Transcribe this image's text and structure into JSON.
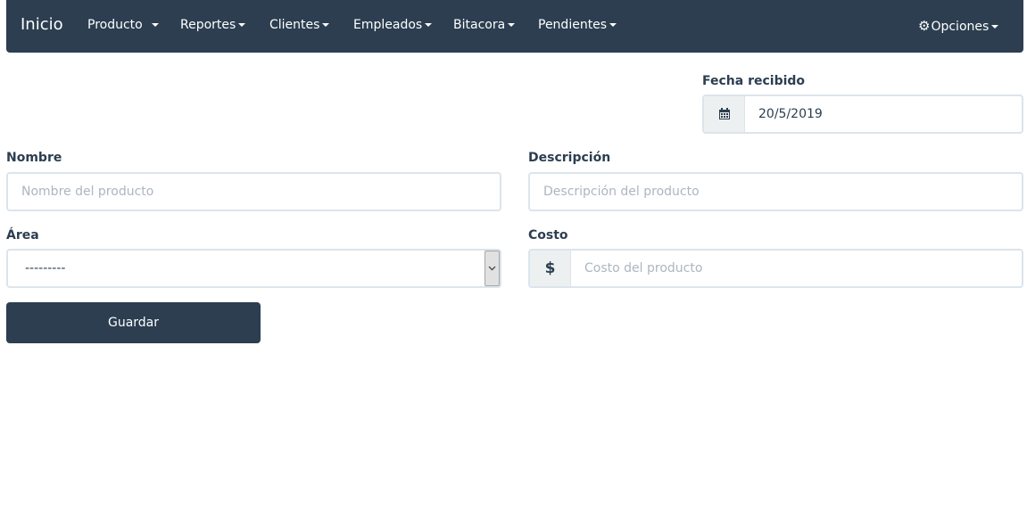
{
  "nav": {
    "brand": "Inicio",
    "items": [
      {
        "label": "Producto"
      },
      {
        "label": "Reportes"
      },
      {
        "label": "Clientes"
      },
      {
        "label": "Empleados"
      },
      {
        "label": "Bitacora"
      },
      {
        "label": "Pendientes"
      }
    ],
    "options_label": "Opciones"
  },
  "form": {
    "fecha": {
      "label": "Fecha recibido",
      "value": "20/5/2019",
      "icon": "calendar-icon"
    },
    "nombre": {
      "label": "Nombre",
      "placeholder": "Nombre del producto",
      "value": ""
    },
    "descripcion": {
      "label": "Descripción",
      "placeholder": "Descripción del producto",
      "value": ""
    },
    "area": {
      "label": "Área",
      "selected": "---------"
    },
    "costo": {
      "label": "Costo",
      "addon": "$",
      "placeholder": "Costo del producto",
      "value": ""
    },
    "save_label": "Guardar"
  },
  "colors": {
    "primary": "#2c3e50",
    "input_border": "#dce4ec",
    "addon_bg": "#ecf0f1",
    "placeholder": "#acb6c0"
  }
}
